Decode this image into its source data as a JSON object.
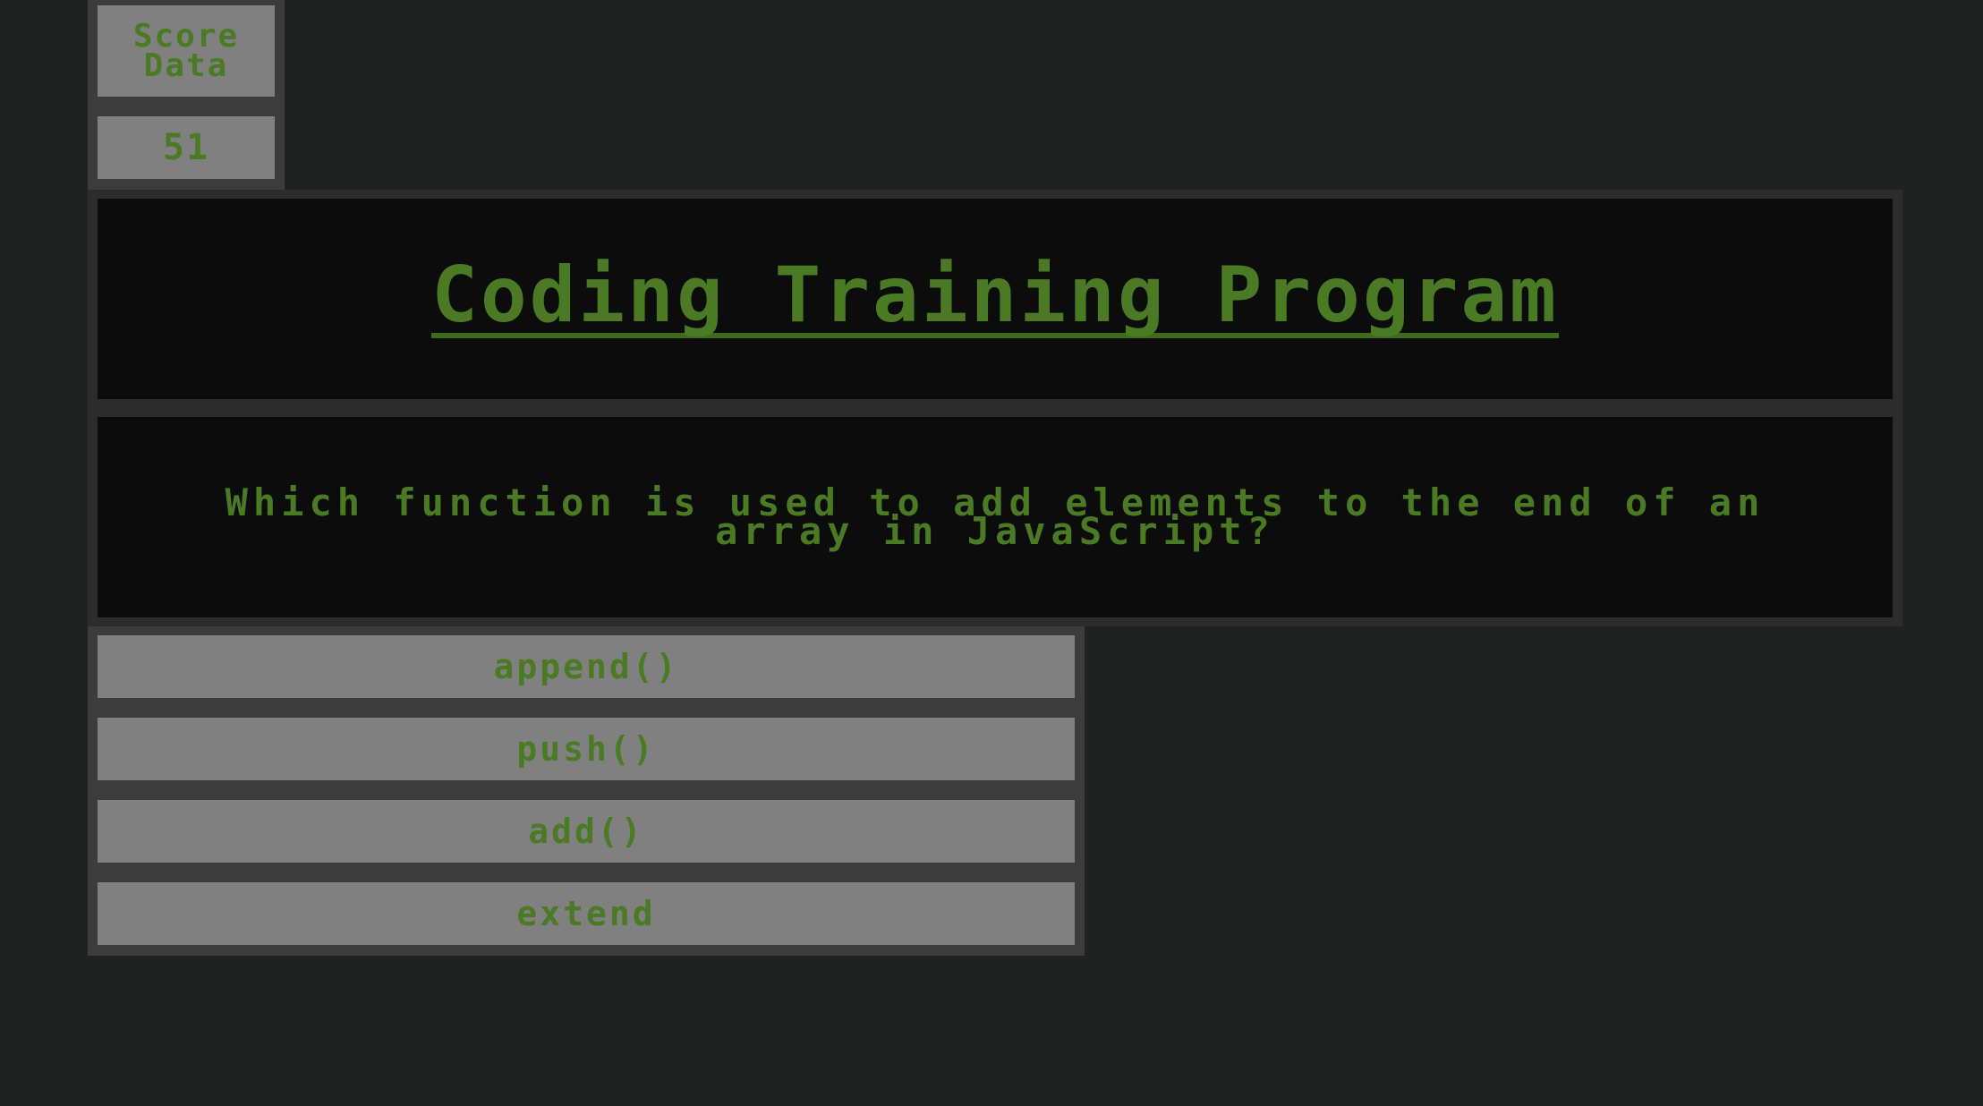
{
  "score": {
    "label": "Score Data",
    "value": "51"
  },
  "title": {
    "text": "Coding Training Program"
  },
  "question": {
    "text": "Which function is used to add elements to the end of an array in JavaScript?"
  },
  "answers": [
    {
      "label": "append()"
    },
    {
      "label": "push()"
    },
    {
      "label": "add()"
    },
    {
      "label": "extend"
    }
  ],
  "colors": {
    "background": "#202222",
    "panel": "#3c3c3c",
    "button": "#808080",
    "text_green": "#4a7a23",
    "dark_box": "#0c0c0c"
  }
}
